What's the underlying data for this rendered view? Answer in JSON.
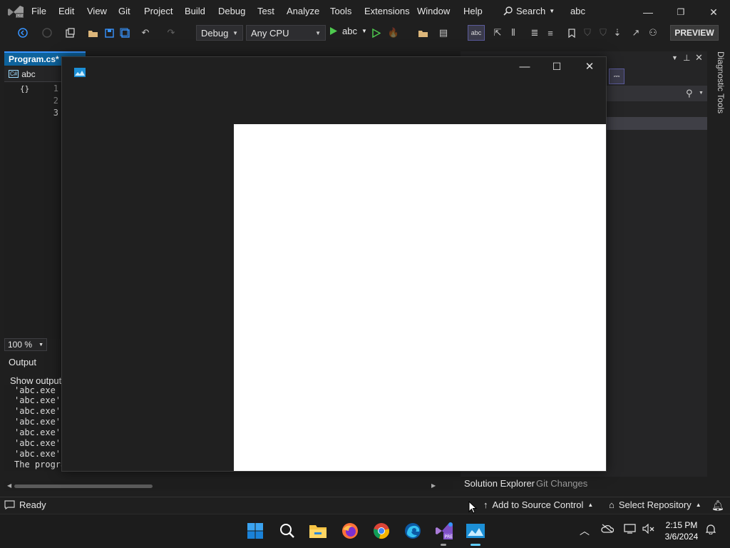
{
  "menubar": {
    "items": [
      "File",
      "Edit",
      "View",
      "Git",
      "Project",
      "Build",
      "Debug",
      "Test",
      "Analyze",
      "Tools",
      "Extensions",
      "Window",
      "Help"
    ],
    "search_label": "Search",
    "solution_name": "abc"
  },
  "toolbar": {
    "config": "Debug",
    "platform": "Any CPU",
    "run_target": "abc",
    "preview_label": "PREVIEW"
  },
  "editor": {
    "tab_label": "Program.cs*",
    "nav_project": "abc",
    "line_numbers": [
      "1",
      "2",
      "3"
    ],
    "zoom": "100 %"
  },
  "output": {
    "title": "Output",
    "show_output_from": "Show output",
    "lines": [
      "'abc.exe",
      "'abc.exe'",
      "'abc.exe'",
      "'abc.exe'",
      "'abc.exe'",
      "'abc.exe'",
      "'abc.exe'",
      "The progra"
    ]
  },
  "right_panel": {
    "tab_solution_explorer": "Solution Explorer",
    "tab_git_changes": "Git Changes",
    "diagnostic_tools": "Diagnostic Tools"
  },
  "statusbar": {
    "ready": "Ready",
    "add_source_control": "Add to Source Control",
    "select_repository": "Select Repository"
  },
  "taskbar": {
    "time": "2:15 PM",
    "date": "3/6/2024"
  },
  "colors": {
    "accent": "#0e639c",
    "win_blue": "#60cdff"
  }
}
